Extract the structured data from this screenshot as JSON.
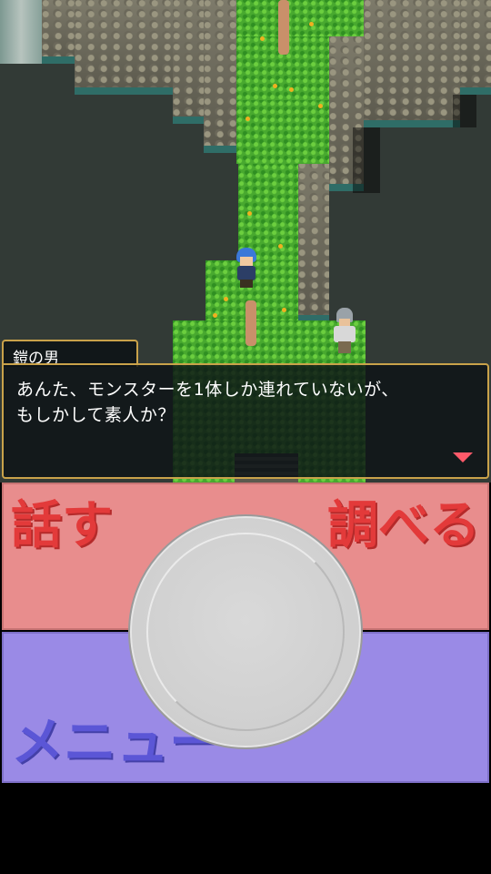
{
  "dialog": {
    "speaker": "鎧の男",
    "line1": "あんた、モンスターを1体しか連れていないが、",
    "line2": "もしかして素人か？",
    "next_indicator": "next-arrow-icon"
  },
  "controls": {
    "talk_label": "話す",
    "examine_label": "調べる",
    "menu_label": "メニュー",
    "pad": "virtual-joystick"
  },
  "colors": {
    "talk_bg": "#e88d8d",
    "menu_bg": "#9a8ae6",
    "talk_text": "#e33a3a",
    "menu_text": "#5b56d6",
    "dialog_border": "#c9a24a",
    "next_arrow": "#ff5a6a"
  }
}
